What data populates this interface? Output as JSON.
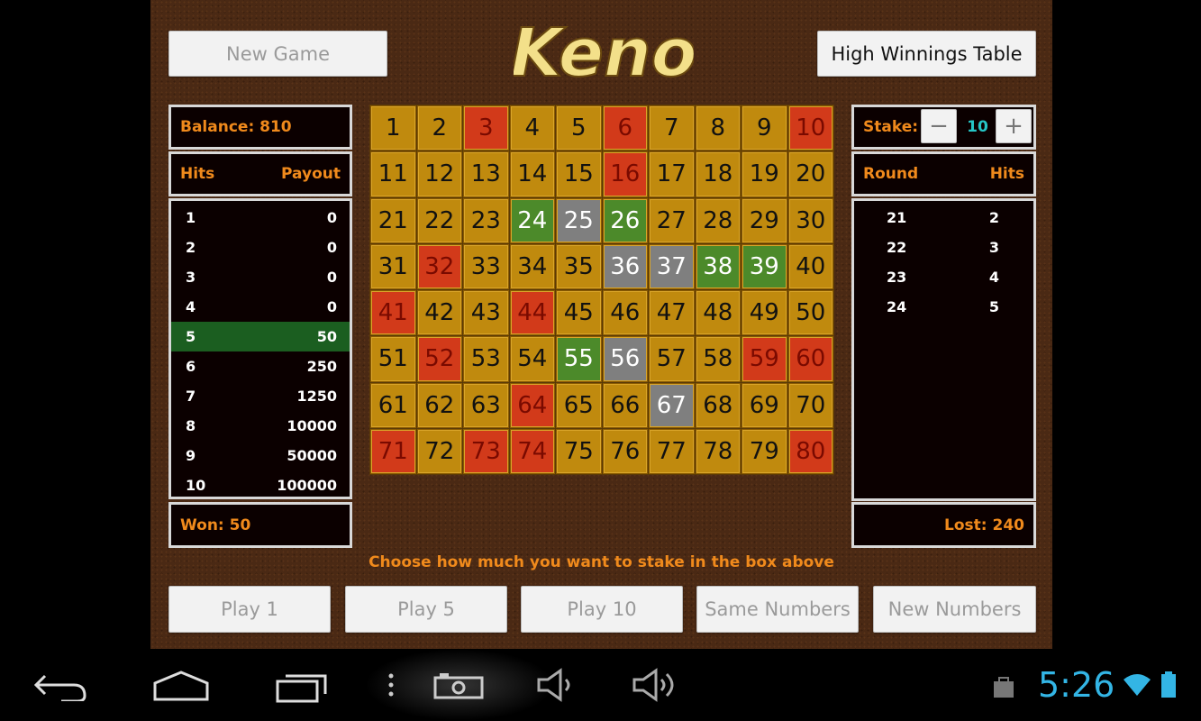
{
  "toolbar": {
    "new_game": "New Game",
    "high_winnings": "High Winnings Table"
  },
  "logo_text": "Keno",
  "left_panel": {
    "balance": "Balance: 810",
    "hits_header": "Hits",
    "payout_header": "Payout",
    "rows": [
      {
        "hits": "1",
        "payout": "0"
      },
      {
        "hits": "2",
        "payout": "0"
      },
      {
        "hits": "3",
        "payout": "0"
      },
      {
        "hits": "4",
        "payout": "0"
      },
      {
        "hits": "5",
        "payout": "50"
      },
      {
        "hits": "6",
        "payout": "250"
      },
      {
        "hits": "7",
        "payout": "1250"
      },
      {
        "hits": "8",
        "payout": "10000"
      },
      {
        "hits": "9",
        "payout": "50000"
      },
      {
        "hits": "10",
        "payout": "100000"
      }
    ],
    "highlight_index": 4,
    "won": "Won: 50"
  },
  "right_panel": {
    "stake_label": "Stake:",
    "stake_value": "10",
    "minus": "−",
    "plus": "+",
    "round_header": "Round",
    "hits_header": "Hits",
    "rows": [
      {
        "round": "21",
        "hits": "2"
      },
      {
        "round": "22",
        "hits": "3"
      },
      {
        "round": "23",
        "hits": "4"
      },
      {
        "round": "24",
        "hits": "5"
      }
    ],
    "lost": "Lost: 240"
  },
  "board": {
    "red": [
      3,
      6,
      10,
      16,
      32,
      41,
      44,
      52,
      59,
      60,
      64,
      71,
      73,
      74,
      80
    ],
    "green": [
      24,
      26,
      38,
      39,
      55
    ],
    "gray": [
      25,
      36,
      37,
      56,
      67
    ]
  },
  "hint": "Choose how much you want to stake in the box above",
  "bottom_buttons": [
    "Play 1",
    "Play 5",
    "Play 10",
    "Same Numbers",
    "New Numbers"
  ],
  "status_bar": {
    "time": "5:26"
  },
  "colors": {
    "accent": "#f08a1c",
    "cell": "#c08a0e",
    "red": "#d23a1a",
    "green": "#4c8a2a",
    "gray": "#7f7f7f",
    "clock": "#33b5e5"
  }
}
